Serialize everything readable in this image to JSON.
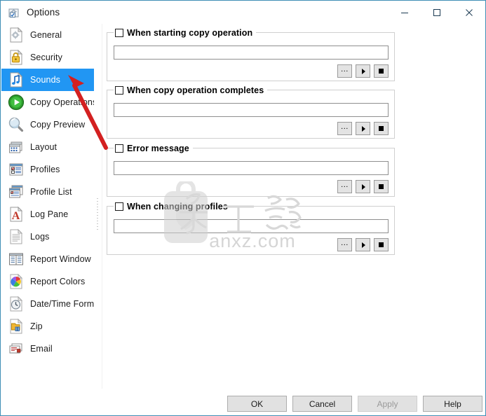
{
  "window": {
    "title": "Options",
    "icon": "options-gear-icon",
    "border_color": "#3f8fb5",
    "controls": [
      {
        "name": "minimize",
        "glyph": "—"
      },
      {
        "name": "maximize",
        "glyph": "□"
      },
      {
        "name": "close",
        "glyph": "✕"
      }
    ]
  },
  "sidebar": {
    "selected": "Sounds",
    "selected_color": "#2196f3",
    "items": [
      {
        "label": "General",
        "icon": "gear-document-icon"
      },
      {
        "label": "Security",
        "icon": "lock-icon"
      },
      {
        "label": "Sounds",
        "icon": "music-note-icon"
      },
      {
        "label": "Copy Operations",
        "icon": "green-play-circle-icon"
      },
      {
        "label": "Copy Preview",
        "icon": "magnifier-icon"
      },
      {
        "label": "Layout",
        "icon": "windows-layout-icon"
      },
      {
        "label": "Profiles",
        "icon": "checklist-window-icon"
      },
      {
        "label": "Profile List",
        "icon": "stacked-windows-icon"
      },
      {
        "label": "Log Pane",
        "icon": "red-letter-a-icon"
      },
      {
        "label": "Logs",
        "icon": "lines-document-icon"
      },
      {
        "label": "Report Window",
        "icon": "report-table-icon"
      },
      {
        "label": "Report Colors",
        "icon": "color-wheel-icon"
      },
      {
        "label": "Date/Time Format",
        "icon": "clock-icon"
      },
      {
        "label": "Zip",
        "icon": "zip-folder-icon"
      },
      {
        "label": "Email",
        "icon": "envelope-stack-icon"
      }
    ]
  },
  "main": {
    "groups": [
      {
        "label": "When starting copy operation",
        "checked": false,
        "value": "",
        "buttons": [
          {
            "name": "browse-button",
            "glyph": "..."
          },
          {
            "name": "play-button",
            "glyph": "▶"
          },
          {
            "name": "stop-button",
            "glyph": "■"
          }
        ]
      },
      {
        "label": "When copy operation completes",
        "checked": false,
        "value": "",
        "buttons": [
          {
            "name": "browse-button",
            "glyph": "..."
          },
          {
            "name": "play-button",
            "glyph": "▶"
          },
          {
            "name": "stop-button",
            "glyph": "■"
          }
        ]
      },
      {
        "label": "Error message",
        "checked": false,
        "value": "",
        "buttons": [
          {
            "name": "browse-button",
            "glyph": "..."
          },
          {
            "name": "play-button",
            "glyph": "▶"
          },
          {
            "name": "stop-button",
            "glyph": "■"
          }
        ]
      },
      {
        "label": "When changing profiles",
        "checked": false,
        "value": "",
        "buttons": [
          {
            "name": "browse-button",
            "glyph": "..."
          },
          {
            "name": "play-button",
            "glyph": "▶"
          },
          {
            "name": "stop-button",
            "glyph": "■"
          }
        ]
      }
    ]
  },
  "footer": {
    "ok": "OK",
    "cancel": "Cancel",
    "apply": "Apply",
    "apply_disabled": true,
    "help": "Help"
  },
  "watermark": {
    "text_cn": "安下载",
    "text_url": "anxz.com",
    "color": "#d2d2d2"
  },
  "annotation": {
    "arrow_color": "#d32020",
    "points_to": "Sounds"
  }
}
